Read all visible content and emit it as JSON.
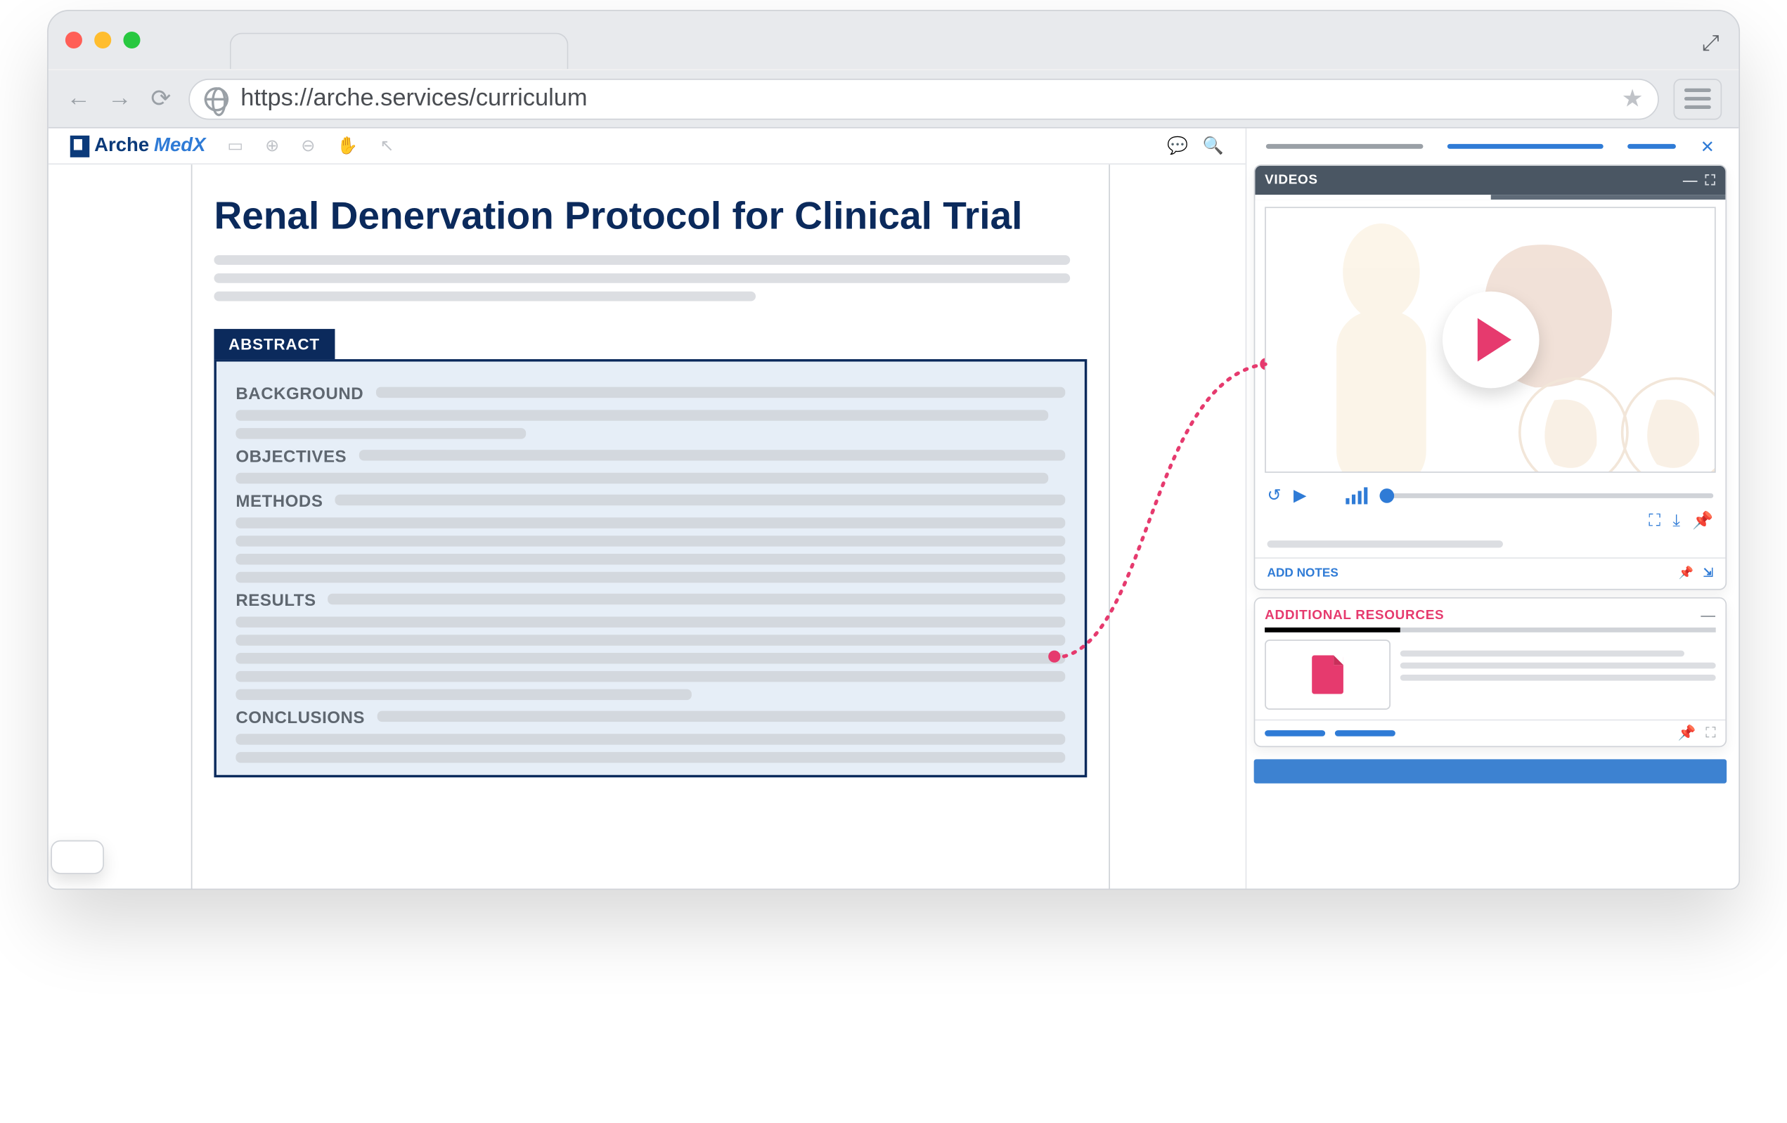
{
  "browser": {
    "url": "https://arche.services/curriculum"
  },
  "app": {
    "brand_a": "Arche",
    "brand_b": "MedX"
  },
  "doc": {
    "title": "Renal Denervation Protocol for Clinical Trial",
    "abstract_label": "ABSTRACT",
    "sections": {
      "background": "BACKGROUND",
      "objectives": "OBJECTIVES",
      "methods": "METHODS",
      "results": "RESULTS",
      "conclusions": "CONCLUSIONS"
    }
  },
  "side": {
    "videos_label": "VIDEOS",
    "add_notes_label": "ADD NOTES",
    "resources_label": "ADDITIONAL RESOURCES"
  }
}
